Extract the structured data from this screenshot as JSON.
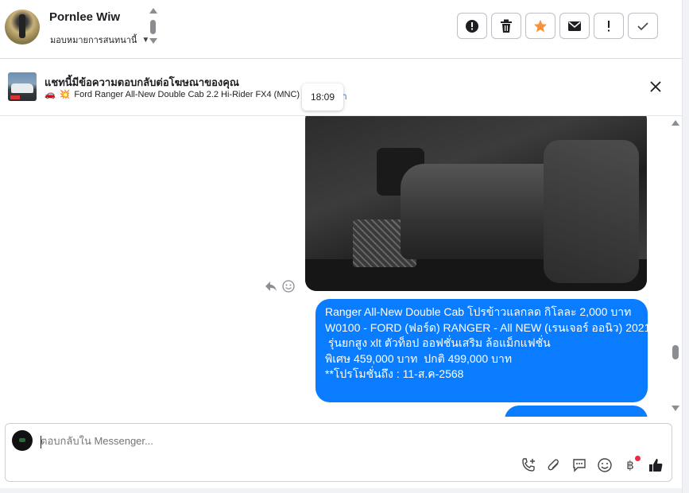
{
  "header": {
    "user_name": "Pornlee Wiw",
    "assign_label": "มอบหมายการสนทนานี้",
    "actions": [
      {
        "name": "report-button",
        "icon": "alert-circle-icon"
      },
      {
        "name": "delete-button",
        "icon": "trash-icon"
      },
      {
        "name": "star-button",
        "icon": "star-icon"
      },
      {
        "name": "mark-unread-button",
        "icon": "envelope-icon"
      },
      {
        "name": "spam-button",
        "icon": "exclamation-icon"
      },
      {
        "name": "done-button",
        "icon": "check-icon"
      }
    ],
    "star_color": "#f7923b"
  },
  "ad_banner": {
    "title": "แชทนี้มีข้อความตอบกลับต่อโฆษณาของคุณ",
    "subtitle": "Ford Ranger All-New Double Cab 2.2 Hi-Rider FX4 (MNC) MT",
    "link_text": "นา",
    "timestamp": "18:09"
  },
  "messages": {
    "bubble1_lines": [
      "Ranger All-New Double Cab โปรข้าวแลกลด กิโลละ 2,000 บาท",
      "W0100 - FORD (ฟอร์ด) RANGER - All NEW (เรนเจอร์ ออนิว) 2021",
      "",
      " รุ่นยกสูง xlt ตัวท็อป ออฟชั่นเสริม ล้อแม็กแฟชั่น",
      "พิเศษ 459,000 บาท  ปกติ 499,000 บาท",
      "**โปรโมชั่นถึง : 11-ส.ค-2568"
    ],
    "bubble_color": "#0a7cff"
  },
  "composer": {
    "placeholder": "ตอบกลับใน Messenger...",
    "tools": [
      "add-call-icon",
      "attachment-icon",
      "saved-reply-icon",
      "emoji-icon",
      "baht-payment-icon",
      "like-icon"
    ],
    "baht_symbol": "฿"
  }
}
